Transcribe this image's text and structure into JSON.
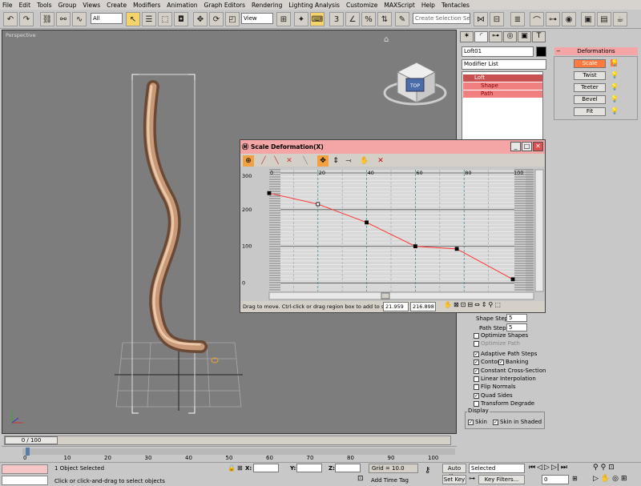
{
  "menu": [
    "File",
    "Edit",
    "Tools",
    "Group",
    "Views",
    "Create",
    "Modifiers",
    "Animation",
    "Graph Editors",
    "Rendering",
    "Lighting Analysis",
    "Customize",
    "MAXScript",
    "Help",
    "Tentacles"
  ],
  "toolbar": {
    "selection_filter": "All",
    "coord_system": "View",
    "named_selection_placeholder": "Create Selection Set"
  },
  "viewport": {
    "label": "Perspective",
    "viewcube_label": "TOP"
  },
  "modify_panel": {
    "object_name": "Loft01",
    "modifier_list": "Modifier List",
    "stack": [
      {
        "label": "Loft",
        "selected": true
      },
      {
        "label": "Shape",
        "selected": false
      },
      {
        "label": "Path",
        "selected": false
      }
    ],
    "shape_steps_label": "Shape Steps:",
    "shape_steps": "5",
    "path_steps_label": "Path Steps:",
    "path_steps": "5",
    "options": [
      {
        "label": "Optimize Shapes",
        "checked": false,
        "dim": false
      },
      {
        "label": "Optimize Path",
        "checked": false,
        "dim": true
      },
      {
        "label": "Adaptive Path Steps",
        "checked": true,
        "dim": false
      },
      {
        "label": "Contour",
        "checked": true,
        "dim": false
      },
      {
        "label": "Constant Cross-Section",
        "checked": true,
        "dim": false
      },
      {
        "label": "Linear Interpolation",
        "checked": false,
        "dim": false
      },
      {
        "label": "Flip Normals",
        "checked": false,
        "dim": false
      },
      {
        "label": "Quad Sides",
        "checked": true,
        "dim": false
      },
      {
        "label": "Transform Degrade",
        "checked": false,
        "dim": false
      }
    ],
    "banking_label": "Banking",
    "display_group": "Display",
    "skin_label": "Skin",
    "skin_shaded_label": "Skin in Shaded"
  },
  "deformations": {
    "title": "Deformations",
    "buttons": [
      {
        "label": "Scale",
        "selected": true
      },
      {
        "label": "Twist",
        "selected": false
      },
      {
        "label": "Teeter",
        "selected": false
      },
      {
        "label": "Bevel",
        "selected": false
      },
      {
        "label": "Fit",
        "selected": false
      }
    ]
  },
  "dialog": {
    "title": "Scale Deformation(X)",
    "status_text": "Drag to move. Ctrl-click or drag region box to add to selec",
    "x_value": "21.959",
    "y_value": "216.898"
  },
  "chart_data": {
    "type": "line",
    "x": [
      0,
      20,
      40,
      60,
      77,
      100
    ],
    "y": [
      245,
      215,
      165,
      100,
      93,
      10
    ],
    "xlim": [
      0,
      100
    ],
    "ylim": [
      -10,
      300
    ],
    "x_ticks": [
      "0",
      "20",
      "40",
      "60",
      "80",
      "100"
    ],
    "y_ticks": [
      "0",
      "100",
      "200",
      "300"
    ],
    "line_color": "#ff3030"
  },
  "timeline": {
    "frame_label": "0 / 100",
    "ticks": [
      "0",
      "10",
      "20",
      "30",
      "40",
      "50",
      "60",
      "70",
      "80",
      "90",
      "100"
    ]
  },
  "status": {
    "objects_selected": "1 Object Selected",
    "prompt": "Click or click-and-drag to select objects",
    "x_label": "X:",
    "y_label": "Y:",
    "z_label": "Z:",
    "grid": "Grid = 10.0",
    "add_time_tag": "Add Time Tag",
    "auto_key": "Auto Key",
    "set_key": "Set Key",
    "key_mode": "Selected",
    "key_filters": "Key Filters...",
    "frame": "0"
  }
}
